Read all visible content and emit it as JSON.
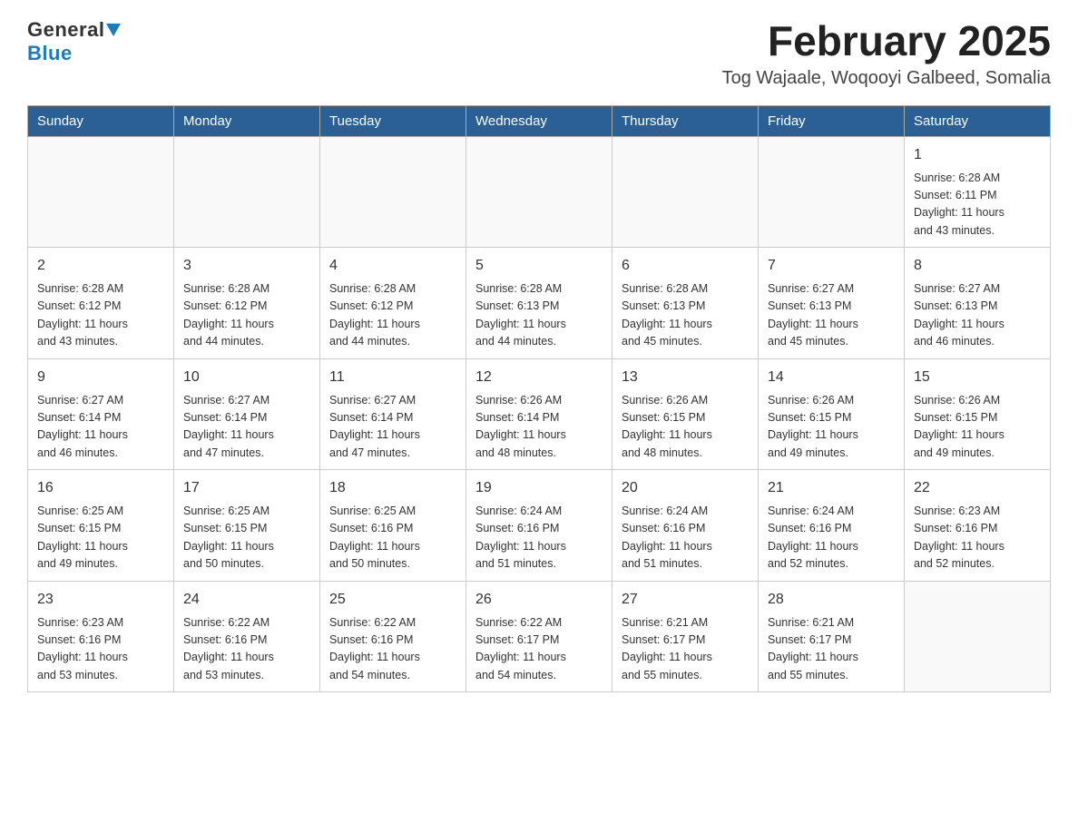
{
  "header": {
    "logo_general": "General",
    "logo_blue": "Blue",
    "month_title": "February 2025",
    "location": "Tog Wajaale, Woqooyi Galbeed, Somalia"
  },
  "days_of_week": [
    "Sunday",
    "Monday",
    "Tuesday",
    "Wednesday",
    "Thursday",
    "Friday",
    "Saturday"
  ],
  "weeks": [
    [
      {
        "day": "",
        "info": ""
      },
      {
        "day": "",
        "info": ""
      },
      {
        "day": "",
        "info": ""
      },
      {
        "day": "",
        "info": ""
      },
      {
        "day": "",
        "info": ""
      },
      {
        "day": "",
        "info": ""
      },
      {
        "day": "1",
        "info": "Sunrise: 6:28 AM\nSunset: 6:11 PM\nDaylight: 11 hours\nand 43 minutes."
      }
    ],
    [
      {
        "day": "2",
        "info": "Sunrise: 6:28 AM\nSunset: 6:12 PM\nDaylight: 11 hours\nand 43 minutes."
      },
      {
        "day": "3",
        "info": "Sunrise: 6:28 AM\nSunset: 6:12 PM\nDaylight: 11 hours\nand 44 minutes."
      },
      {
        "day": "4",
        "info": "Sunrise: 6:28 AM\nSunset: 6:12 PM\nDaylight: 11 hours\nand 44 minutes."
      },
      {
        "day": "5",
        "info": "Sunrise: 6:28 AM\nSunset: 6:13 PM\nDaylight: 11 hours\nand 44 minutes."
      },
      {
        "day": "6",
        "info": "Sunrise: 6:28 AM\nSunset: 6:13 PM\nDaylight: 11 hours\nand 45 minutes."
      },
      {
        "day": "7",
        "info": "Sunrise: 6:27 AM\nSunset: 6:13 PM\nDaylight: 11 hours\nand 45 minutes."
      },
      {
        "day": "8",
        "info": "Sunrise: 6:27 AM\nSunset: 6:13 PM\nDaylight: 11 hours\nand 46 minutes."
      }
    ],
    [
      {
        "day": "9",
        "info": "Sunrise: 6:27 AM\nSunset: 6:14 PM\nDaylight: 11 hours\nand 46 minutes."
      },
      {
        "day": "10",
        "info": "Sunrise: 6:27 AM\nSunset: 6:14 PM\nDaylight: 11 hours\nand 47 minutes."
      },
      {
        "day": "11",
        "info": "Sunrise: 6:27 AM\nSunset: 6:14 PM\nDaylight: 11 hours\nand 47 minutes."
      },
      {
        "day": "12",
        "info": "Sunrise: 6:26 AM\nSunset: 6:14 PM\nDaylight: 11 hours\nand 48 minutes."
      },
      {
        "day": "13",
        "info": "Sunrise: 6:26 AM\nSunset: 6:15 PM\nDaylight: 11 hours\nand 48 minutes."
      },
      {
        "day": "14",
        "info": "Sunrise: 6:26 AM\nSunset: 6:15 PM\nDaylight: 11 hours\nand 49 minutes."
      },
      {
        "day": "15",
        "info": "Sunrise: 6:26 AM\nSunset: 6:15 PM\nDaylight: 11 hours\nand 49 minutes."
      }
    ],
    [
      {
        "day": "16",
        "info": "Sunrise: 6:25 AM\nSunset: 6:15 PM\nDaylight: 11 hours\nand 49 minutes."
      },
      {
        "day": "17",
        "info": "Sunrise: 6:25 AM\nSunset: 6:15 PM\nDaylight: 11 hours\nand 50 minutes."
      },
      {
        "day": "18",
        "info": "Sunrise: 6:25 AM\nSunset: 6:16 PM\nDaylight: 11 hours\nand 50 minutes."
      },
      {
        "day": "19",
        "info": "Sunrise: 6:24 AM\nSunset: 6:16 PM\nDaylight: 11 hours\nand 51 minutes."
      },
      {
        "day": "20",
        "info": "Sunrise: 6:24 AM\nSunset: 6:16 PM\nDaylight: 11 hours\nand 51 minutes."
      },
      {
        "day": "21",
        "info": "Sunrise: 6:24 AM\nSunset: 6:16 PM\nDaylight: 11 hours\nand 52 minutes."
      },
      {
        "day": "22",
        "info": "Sunrise: 6:23 AM\nSunset: 6:16 PM\nDaylight: 11 hours\nand 52 minutes."
      }
    ],
    [
      {
        "day": "23",
        "info": "Sunrise: 6:23 AM\nSunset: 6:16 PM\nDaylight: 11 hours\nand 53 minutes."
      },
      {
        "day": "24",
        "info": "Sunrise: 6:22 AM\nSunset: 6:16 PM\nDaylight: 11 hours\nand 53 minutes."
      },
      {
        "day": "25",
        "info": "Sunrise: 6:22 AM\nSunset: 6:16 PM\nDaylight: 11 hours\nand 54 minutes."
      },
      {
        "day": "26",
        "info": "Sunrise: 6:22 AM\nSunset: 6:17 PM\nDaylight: 11 hours\nand 54 minutes."
      },
      {
        "day": "27",
        "info": "Sunrise: 6:21 AM\nSunset: 6:17 PM\nDaylight: 11 hours\nand 55 minutes."
      },
      {
        "day": "28",
        "info": "Sunrise: 6:21 AM\nSunset: 6:17 PM\nDaylight: 11 hours\nand 55 minutes."
      },
      {
        "day": "",
        "info": ""
      }
    ]
  ]
}
